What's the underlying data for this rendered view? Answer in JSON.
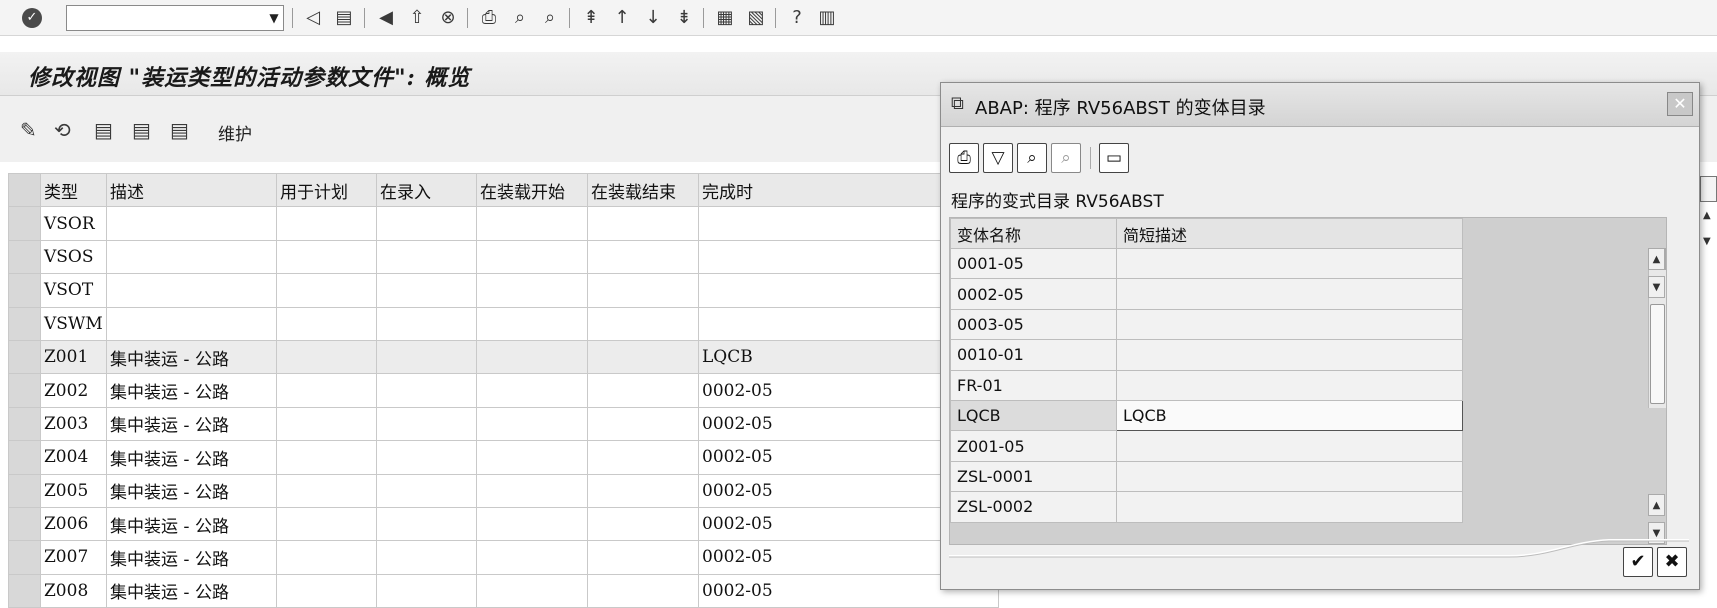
{
  "system_toolbar": {
    "command_field_value": "",
    "icons": [
      "enter-icon",
      "back-icon",
      "save-icon",
      "nav-back-icon",
      "exit-icon",
      "cancel-icon",
      "print-icon",
      "find-icon",
      "find-next-icon",
      "first-page-icon",
      "prev-page-icon",
      "next-page-icon",
      "last-page-icon",
      "new-session-icon",
      "shortcut-icon",
      "help-icon",
      "layout-icon"
    ]
  },
  "page": {
    "title": "修改视图 \"装运类型的活动参数文件\": 概览"
  },
  "app_toolbar": {
    "maintain_label": "维护"
  },
  "main_table": {
    "columns": [
      "类型",
      "描述",
      "用于计划",
      "在录入",
      "在装载开始",
      "在装载结束",
      "完成时"
    ],
    "rows": [
      [
        "VSOR",
        "",
        "",
        "",
        "",
        "",
        ""
      ],
      [
        "VSOS",
        "",
        "",
        "",
        "",
        "",
        ""
      ],
      [
        "VSOT",
        "",
        "",
        "",
        "",
        "",
        ""
      ],
      [
        "VSWM",
        "",
        "",
        "",
        "",
        "",
        ""
      ],
      [
        "Z001",
        "集中装运 - 公路",
        "",
        "",
        "",
        "",
        "LQCB"
      ],
      [
        "Z002",
        "集中装运 - 公路",
        "",
        "",
        "",
        "",
        "0002-05"
      ],
      [
        "Z003",
        "集中装运 - 公路",
        "",
        "",
        "",
        "",
        "0002-05"
      ],
      [
        "Z004",
        "集中装运 - 公路",
        "",
        "",
        "",
        "",
        "0002-05"
      ],
      [
        "Z005",
        "集中装运 - 公路",
        "",
        "",
        "",
        "",
        "0002-05"
      ],
      [
        "Z006",
        "集中装运 - 公路",
        "",
        "",
        "",
        "",
        "0002-05"
      ],
      [
        "Z007",
        "集中装运 - 公路",
        "",
        "",
        "",
        "",
        "0002-05"
      ],
      [
        "Z008",
        "集中装运 - 公路",
        "",
        "",
        "",
        "",
        "0002-05"
      ]
    ]
  },
  "dialog": {
    "title": "ABAP: 程序 RV56ABST 的变体目录",
    "subtitle": "程序的变式目录 RV56ABST",
    "columns": [
      "变体名称",
      "简短描述"
    ],
    "rows": [
      {
        "name": "0001-05",
        "desc": ""
      },
      {
        "name": "0002-05",
        "desc": ""
      },
      {
        "name": "0003-05",
        "desc": ""
      },
      {
        "name": "0010-01",
        "desc": ""
      },
      {
        "name": "FR-01",
        "desc": ""
      },
      {
        "name": "LQCB",
        "desc": "LQCB"
      },
      {
        "name": "Z001-05",
        "desc": ""
      },
      {
        "name": "ZSL-0001",
        "desc": ""
      },
      {
        "name": "ZSL-0002",
        "desc": ""
      }
    ],
    "selected_row": "LQCB"
  }
}
